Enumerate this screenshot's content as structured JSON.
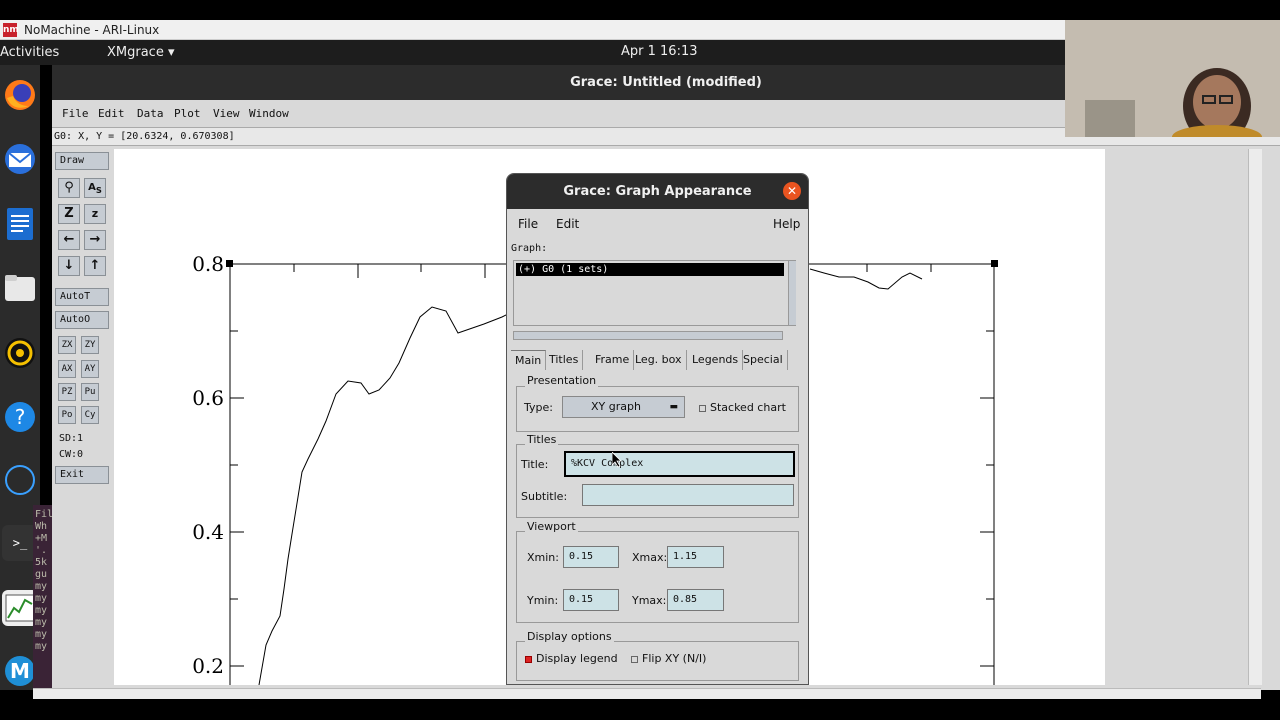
{
  "nomachine": {
    "title": "NoMachine - ARI-Linux",
    "icon_text": "nm"
  },
  "gnome": {
    "activities": "Activities",
    "app_menu": "XMgrace ▾",
    "clock": "Apr 1  16:13"
  },
  "dock": {
    "terminal_prompt": ">_"
  },
  "grace": {
    "title": "Grace: Untitled (modified)",
    "menu": [
      "File",
      "Edit",
      "Data",
      "Plot",
      "View",
      "Window"
    ],
    "status": "G0: X, Y = [20.6324, 0.670308]",
    "toolbar": {
      "draw": "Draw",
      "autot": "AutoT",
      "autoo": "AutoO",
      "small": [
        [
          "ZX",
          "ZY"
        ],
        [
          "AX",
          "AY"
        ],
        [
          "PZ",
          "Pu"
        ],
        [
          "Po",
          "Cy"
        ]
      ],
      "sd": "SD:1",
      "cw": "CW:0",
      "exit": "Exit"
    },
    "axis_labels": [
      "0.8",
      "0.6",
      "0.4",
      "0.2"
    ],
    "terminal_text": [
      "Fil",
      "Wh",
      "+M",
      "'.",
      "5k",
      "gu",
      "my",
      "my",
      "my",
      "my",
      "my",
      "my"
    ]
  },
  "dialog": {
    "title": "Grace: Graph Appearance",
    "menu": {
      "file": "File",
      "edit": "Edit",
      "help": "Help"
    },
    "graph_label": "Graph:",
    "graph_item": "(+) G0 (1 sets)",
    "tabs": [
      "Main",
      "Titles",
      "Frame",
      "Leg. box",
      "Legends",
      "Special"
    ],
    "presentation": {
      "label": "Presentation",
      "type_label": "Type:",
      "type_value": "XY graph",
      "stacked": "Stacked chart"
    },
    "titles": {
      "label": "Titles",
      "title_label": "Title:",
      "title_value": "%KCV Complex",
      "subtitle_label": "Subtitle:",
      "subtitle_value": ""
    },
    "viewport": {
      "label": "Viewport",
      "xmin_label": "Xmin:",
      "xmin": "0.15",
      "xmax_label": "Xmax:",
      "xmax": "1.15",
      "ymin_label": "Ymin:",
      "ymin": "0.15",
      "ymax_label": "Ymax:",
      "ymax": "0.85"
    },
    "display": {
      "label": "Display options",
      "legend": "Display legend",
      "flip": "Flip XY (N/I)"
    }
  }
}
